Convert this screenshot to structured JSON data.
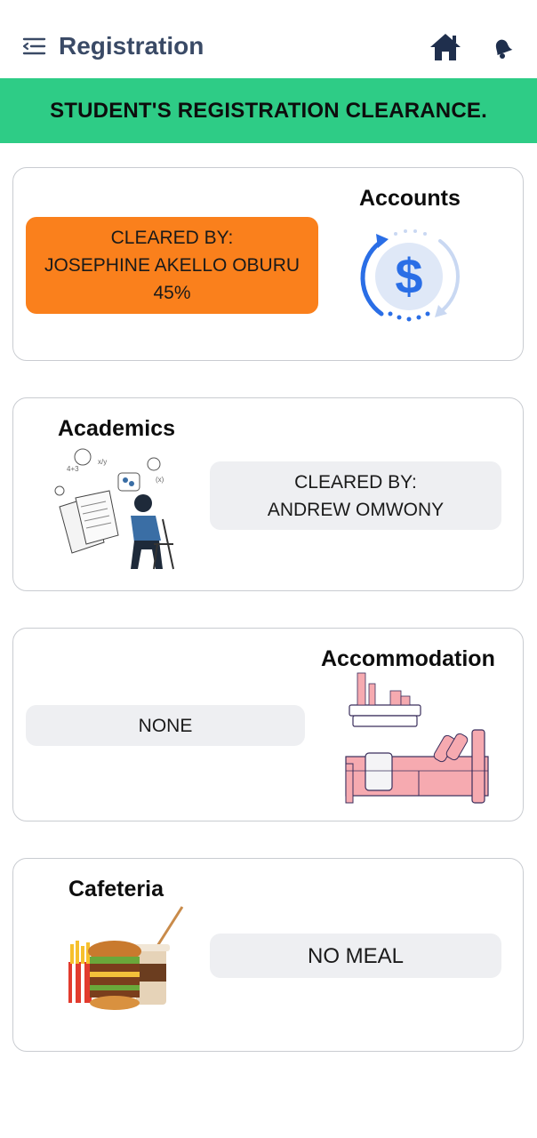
{
  "header": {
    "title": "Registration",
    "menu_icon": "menu-icon",
    "home_icon": "home-icon",
    "bell_icon": "bell-icon"
  },
  "banner": {
    "text": "STUDENT'S REGISTRATION CLEARANCE.",
    "color": "#2ecc86"
  },
  "cards": [
    {
      "title": "Accounts",
      "status_line1": "CLEARED BY:",
      "status_line2": "JOSEPHINE AKELLO OBURU",
      "status_line3": "45%",
      "status_color": "#fa801c",
      "illustration": "dollar-cycle-icon"
    },
    {
      "title": "Academics",
      "status_line1": "CLEARED BY:",
      "status_line2": "ANDREW OMWONY",
      "illustration": "student-studying-illustration"
    },
    {
      "title": "Accommodation",
      "status_line1": "NONE",
      "illustration": "bed-illustration"
    },
    {
      "title": "Cafeteria",
      "status_line1": "NO MEAL",
      "illustration": "fast-food-illustration"
    }
  ]
}
